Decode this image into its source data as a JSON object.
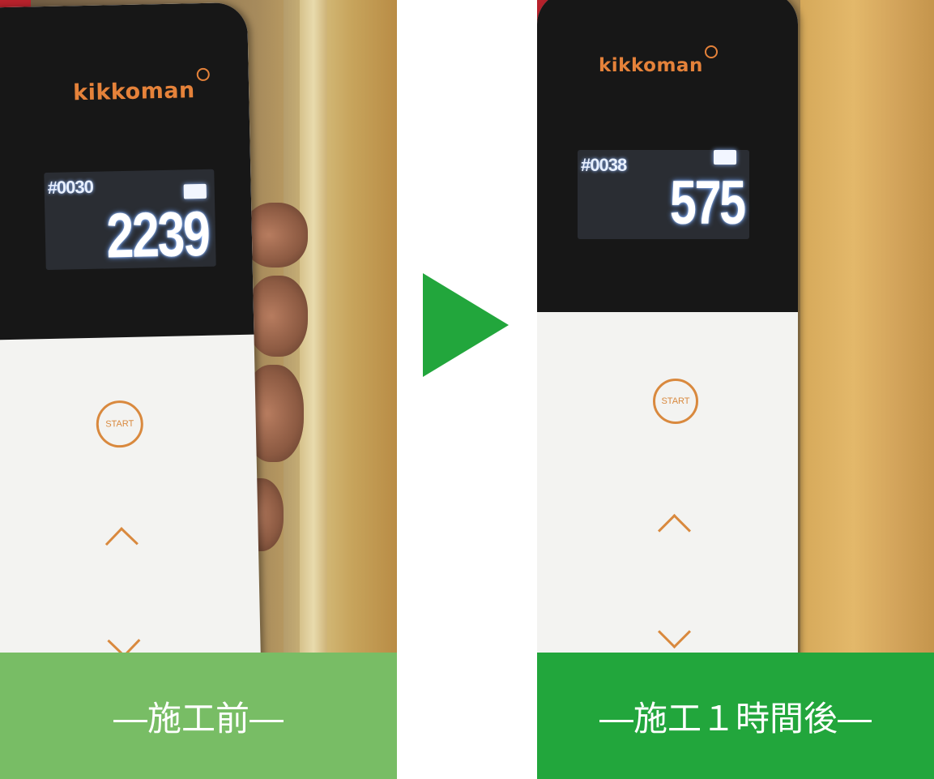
{
  "before": {
    "brand": "kikkoman",
    "display_id": "#0030",
    "display_value": "2239",
    "start_label": "START",
    "caption": "―施工前―"
  },
  "after": {
    "brand": "kikkoman",
    "display_id": "#0038",
    "display_value": "575",
    "start_label": "START",
    "caption": "―施工１時間後―"
  },
  "icons": {
    "arrow": "play-triangle-icon",
    "up": "chevron-up-icon",
    "down": "chevron-down-icon"
  },
  "colors": {
    "caption_before": "#78bd65",
    "caption_after": "#22a63c",
    "arrow": "#22a63c",
    "brand": "#e5823a"
  }
}
